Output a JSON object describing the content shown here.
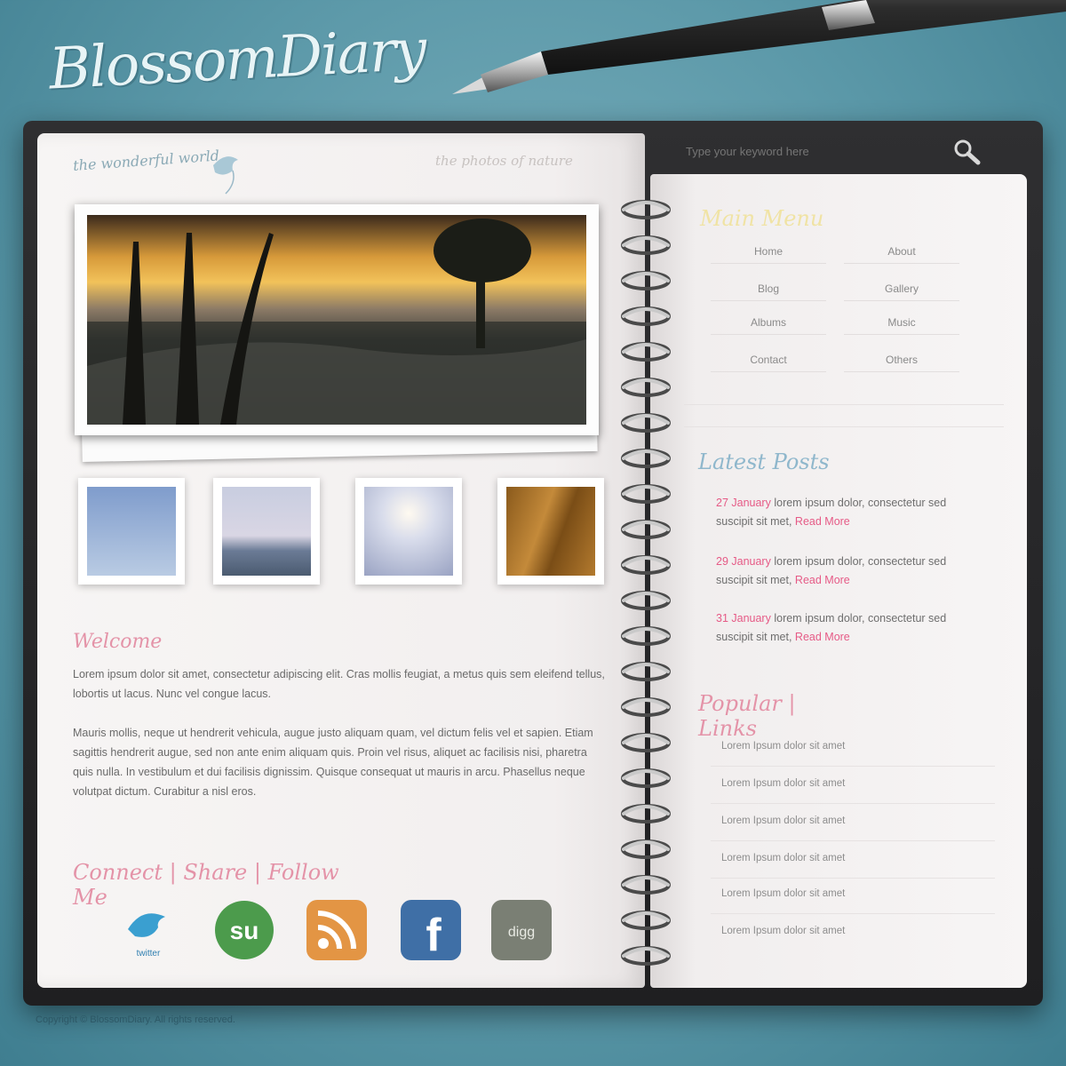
{
  "brand": {
    "logo_text": "BlossomDiary"
  },
  "search": {
    "placeholder": "Type your keyword here"
  },
  "left_page": {
    "title": "the wonderful world",
    "subtitle": "the photos of nature",
    "welcome_heading": "Welcome",
    "paragraph_1": "Lorem ipsum dolor sit amet, consectetur adipiscing elit. Cras mollis feugiat, a metus quis sem eleifend tellus, lobortis ut lacus. Nunc vel congue lacus.",
    "paragraph_2": "Mauris mollis, neque ut hendrerit vehicula, augue justo aliquam quam, vel dictum felis vel et sapien. Etiam sagittis hendrerit augue, sed non ante enim aliquam quis. Proin vel risus, aliquet ac facilisis nisi, pharetra quis nulla. In vestibulum et dui facilisis dignissim. Quisque consequat ut mauris in arcu. Phasellus neque volutpat dictum. Curabitur a nisl eros.",
    "connect_heading": "Connect | Share | Follow Me",
    "social": [
      {
        "name": "twitter",
        "label": "twitter",
        "color": "#3a9fd0"
      },
      {
        "name": "stumbleupon",
        "label": "su",
        "color": "#4c9b4c"
      },
      {
        "name": "rss",
        "label": "",
        "color": "#e39544"
      },
      {
        "name": "facebook",
        "label": "f",
        "color": "#3f6fa6"
      },
      {
        "name": "digg",
        "label": "digg",
        "color": "#7a7f74"
      }
    ]
  },
  "right_page": {
    "nav_heading": "Main Menu",
    "nav_links": [
      "Home",
      "About",
      "Blog",
      "Gallery",
      "Albums",
      "Music",
      "Contact",
      "Others"
    ],
    "latest_heading": "Latest Posts",
    "posts": [
      {
        "link": "27 January",
        "text": "lorem ipsum dolor, consectetur sed suscipit sit met,",
        "more": "Read More"
      },
      {
        "link": "29 January",
        "text": "lorem ipsum dolor, consectetur sed suscipit sit met,",
        "more": "Read More"
      },
      {
        "link": "31 January",
        "text": "lorem ipsum dolor, consectetur sed suscipit sit met,",
        "more": "Read More"
      }
    ],
    "popular_heading": "Popular | Links",
    "popular_links": [
      "Lorem Ipsum dolor sit amet",
      "Lorem Ipsum dolor sit amet",
      "Lorem Ipsum dolor sit amet",
      "Lorem Ipsum dolor sit amet",
      "Lorem Ipsum dolor sit amet",
      "Lorem Ipsum dolor sit amet"
    ]
  },
  "footer": {
    "text": "Copyright © BlossomDiary. All rights reserved."
  },
  "colors": {
    "background": "#5b98a8",
    "accent_pink": "#e65a86",
    "heading_blue": "#8fb7cc",
    "heading_yellow": "#f0e3a4"
  }
}
